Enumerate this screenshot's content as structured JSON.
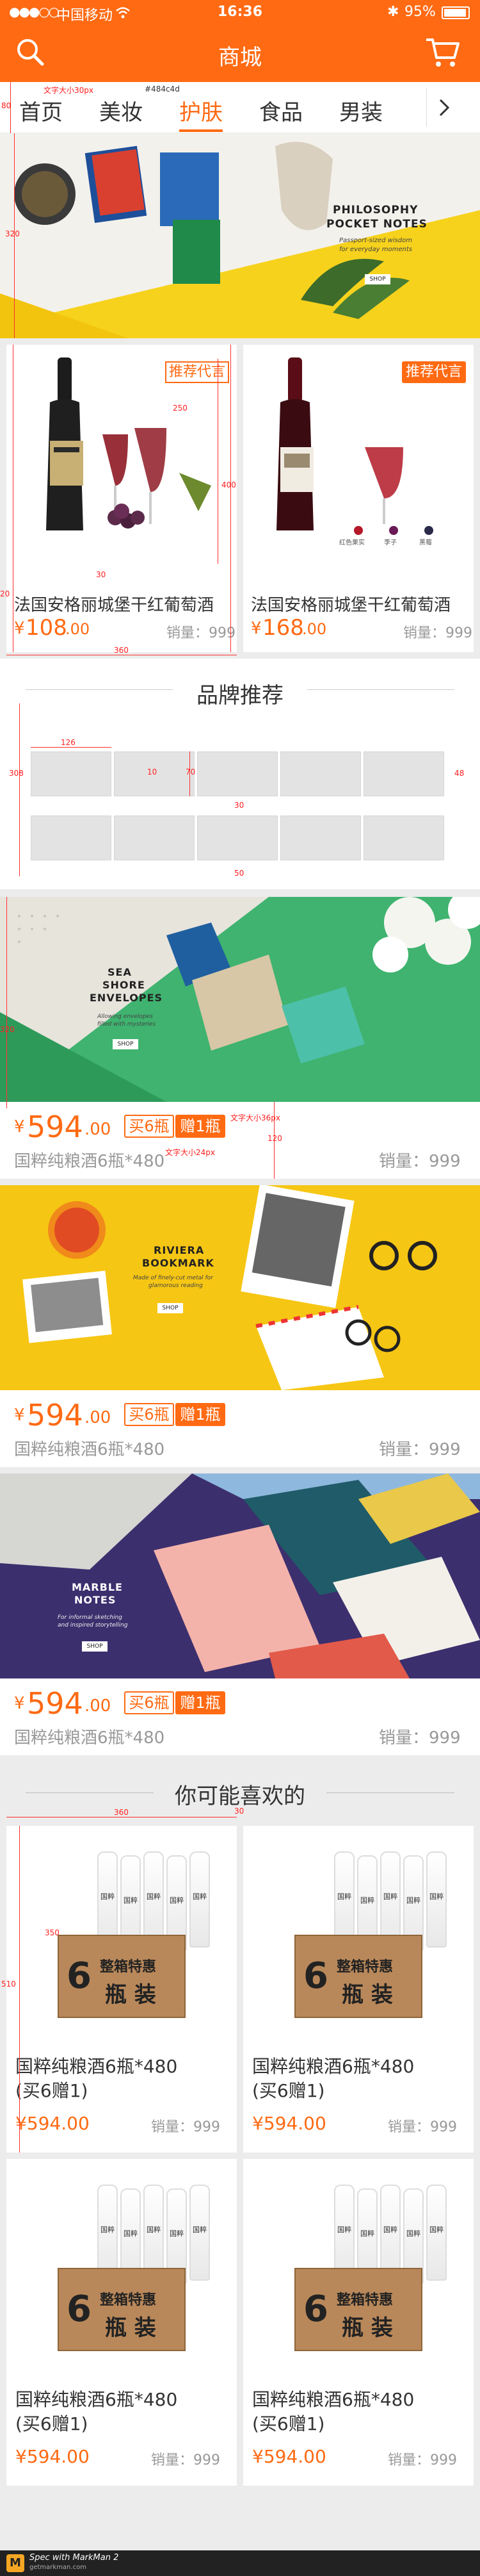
{
  "status": {
    "carrier": "中国移动",
    "time": "16:36",
    "battery": "95%"
  },
  "header": {
    "title": "商城"
  },
  "tabs": [
    {
      "label": "首页",
      "active": false
    },
    {
      "label": "美妆",
      "active": false
    },
    {
      "label": "护肤",
      "active": true
    },
    {
      "label": "食品",
      "active": false
    },
    {
      "label": "男装",
      "active": false
    }
  ],
  "hero_banner": {
    "headline_1": "PHILOSOPHY",
    "headline_2": "POCKET NOTES",
    "sub_1": "Passport-sized wisdom",
    "sub_2": "for everyday moments",
    "button": "SHOP"
  },
  "products_top": [
    {
      "badge": "推荐代言",
      "name": "法国安格丽城堡干红葡萄酒",
      "price_symbol": "¥",
      "price_int": "108",
      "price_dec": ".00",
      "sales": "销量：999"
    },
    {
      "badge": "推荐代言",
      "name": "法国安格丽城堡干红葡萄酒",
      "price_symbol": "¥",
      "price_int": "168",
      "price_dec": ".00",
      "sales": "销量：999",
      "legend": [
        "红色果实",
        "李子",
        "黑莓"
      ]
    }
  ],
  "brand_section": {
    "title": "品牌推荐"
  },
  "promo_banners": [
    {
      "headline_1": "SEA",
      "headline_2": "SHORE",
      "headline_3": "ENVELOPES",
      "sub_1": "Allowing envelopes",
      "sub_2": "filled with mysteries",
      "button": "SHOP",
      "price_symbol": "¥",
      "price_int": "594",
      "price_dec": ".00",
      "tag_buy": "买6瓶",
      "tag_gift": "赠1瓶",
      "name": "国粹纯粮酒6瓶*480",
      "sales": "销量：999"
    },
    {
      "headline_1": "RIVIERA",
      "headline_2": "BOOKMARK",
      "sub_1": "Made of finely-cut metal for",
      "sub_2": "glamorous reading",
      "button": "SHOP",
      "price_symbol": "¥",
      "price_int": "594",
      "price_dec": ".00",
      "tag_buy": "买6瓶",
      "tag_gift": "赠1瓶",
      "name": "国粹纯粮酒6瓶*480",
      "sales": "销量：999"
    },
    {
      "headline_1": "MARBLE",
      "headline_2": "NOTES",
      "sub_1": "For informal sketching",
      "sub_2": "and inspired storytelling",
      "button": "SHOP",
      "price_symbol": "¥",
      "price_int": "594",
      "price_dec": ".00",
      "tag_buy": "买6瓶",
      "tag_gift": "赠1瓶",
      "name": "国粹纯粮酒6瓶*480",
      "sales": "销量：999"
    }
  ],
  "like_section": {
    "title": "你可能喜欢的"
  },
  "like_products": [
    {
      "name_1": "国粹纯粮酒6瓶*480",
      "name_2": "(买6赠1)",
      "price": "¥594.00",
      "sales": "销量：999",
      "box_big": "6",
      "box_text_1": "整箱特惠",
      "box_text_2": "瓶 装",
      "bottle_label": "国粹"
    },
    {
      "name_1": "国粹纯粮酒6瓶*480",
      "name_2": "(买6赠1)",
      "price": "¥594.00",
      "sales": "销量：999",
      "box_big": "6",
      "box_text_1": "整箱特惠",
      "box_text_2": "瓶 装",
      "bottle_label": "国粹"
    },
    {
      "name_1": "国粹纯粮酒6瓶*480",
      "name_2": "(买6赠1)",
      "price": "¥594.00",
      "sales": "销量：999",
      "box_big": "6",
      "box_text_1": "整箱特惠",
      "box_text_2": "瓶 装",
      "bottle_label": "国粹"
    },
    {
      "name_1": "国粹纯粮酒6瓶*480",
      "name_2": "(买6赠1)",
      "price": "¥594.00",
      "sales": "销量：999",
      "box_big": "6",
      "box_text_1": "整箱特惠",
      "box_text_2": "瓶 装",
      "bottle_label": "国粹"
    }
  ],
  "annotations": {
    "font_size_32": "文字大小30px",
    "color_code": "#484c4d",
    "font_size_30b": "文字大小30px",
    "font_size_36": "文字大小36px",
    "font_size_24": "文字大小24px",
    "font_size_24b": "文字大小24px",
    "d80": "80",
    "d40": "40",
    "d30": "30",
    "d320": "320",
    "d120": "120",
    "d400": "400",
    "d250": "250",
    "d360": "360",
    "d126": "126",
    "d70": "70",
    "d48": "48",
    "d50": "50",
    "d10": "10",
    "d308": "308",
    "d350": "350",
    "d510": "510",
    "d60": "60",
    "d20": "20"
  },
  "footer": {
    "brand": "Spec with MarkMan 2",
    "url": "getmarkman.com"
  },
  "colors": {
    "accent": "#ff6a13",
    "spec_red": "#ff3030"
  }
}
